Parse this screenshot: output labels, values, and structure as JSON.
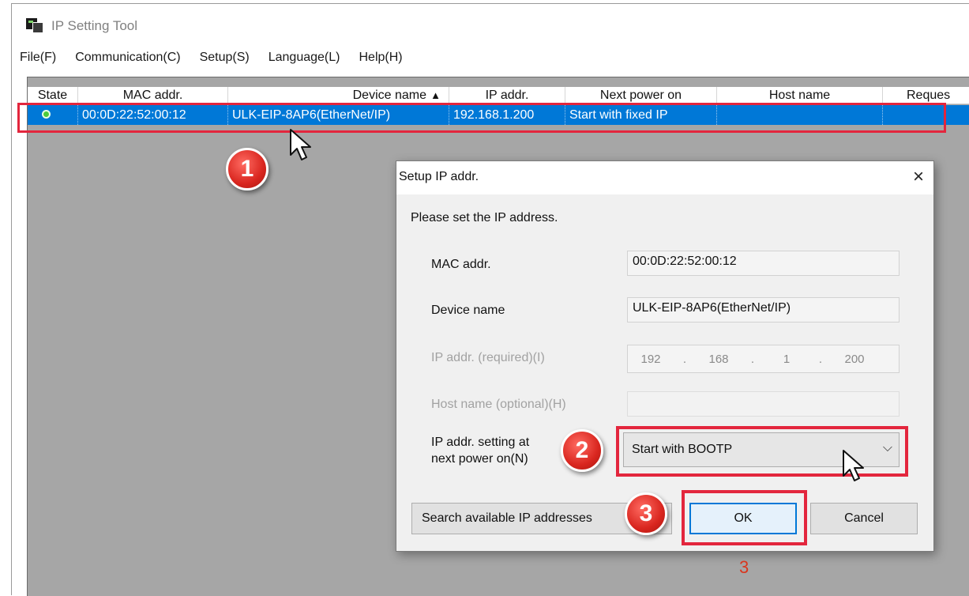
{
  "window": {
    "title": "IP Setting Tool"
  },
  "menu": [
    "File(F)",
    "Communication(C)",
    "Setup(S)",
    "Language(L)",
    "Help(H)"
  ],
  "table": {
    "columns": [
      "State",
      "MAC addr.",
      "Device name",
      "IP addr.",
      "Next power on",
      "Host name",
      "Reques"
    ],
    "sort_indicator": "▲",
    "rows": [
      {
        "state": "online",
        "mac": "00:0D:22:52:00:12",
        "device": "ULK-EIP-8AP6(EtherNet/IP)",
        "ip": "192.168.1.200",
        "next_power_on": "Start with fixed IP",
        "host": "",
        "request": ""
      }
    ]
  },
  "dialog": {
    "title": "Setup IP addr.",
    "close_glyph": "×",
    "prompt": "Please set the IP address.",
    "mac_label": "MAC addr.",
    "mac_value": "00:0D:22:52:00:12",
    "device_label": "Device name",
    "device_value": "ULK-EIP-8AP6(EtherNet/IP)",
    "ip_label": "IP addr. (required)(I)",
    "ip_octets": [
      "192",
      "168",
      "1",
      "200"
    ],
    "ip_separator": ".",
    "host_label": "Host name (optional)(H)",
    "host_value": "",
    "setting_label_1": "IP addr. setting at",
    "setting_label_2": "next power on(N)",
    "setting_value": "Start with BOOTP",
    "combo_arrow": "⌵",
    "search_button": "Search available IP addresses",
    "ok_button": "OK",
    "cancel_button": "Cancel"
  },
  "annotations": {
    "step1": "1",
    "step2": "2",
    "step3": "3",
    "bottom_number": "3",
    "highlight_color": "#e3263d"
  },
  "colors": {
    "selection": "#0078d7",
    "state_online": "#4ccb3c"
  }
}
